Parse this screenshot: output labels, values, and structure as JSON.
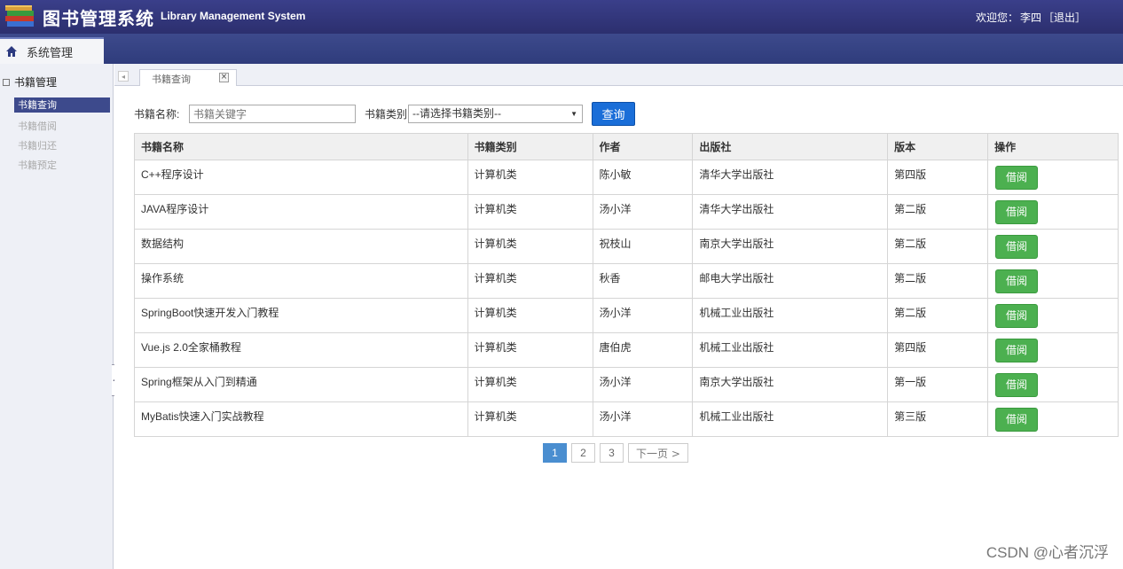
{
  "header": {
    "title": "图书管理系统",
    "subtitle": "Library Management System",
    "welcome_label": "欢迎您：",
    "user_name": "李四",
    "logout_label": "［退出］"
  },
  "nav": {
    "tab_label": "系统管理"
  },
  "sidebar": {
    "group_label": "书籍管理",
    "items": [
      {
        "label": "书籍查询"
      },
      {
        "label": "书籍借阅"
      },
      {
        "label": "书籍归还"
      },
      {
        "label": "书籍预定"
      }
    ]
  },
  "tabs": {
    "active_label": "书籍查询",
    "close_glyph": "×"
  },
  "search": {
    "name_label": "书籍名称:",
    "name_placeholder": "书籍关键字",
    "category_label": "书籍类别:",
    "category_selected": "--请选择书籍类别--",
    "query_label": "查询"
  },
  "table": {
    "columns": [
      "书籍名称",
      "书籍类别",
      "作者",
      "出版社",
      "版本",
      "操作"
    ],
    "rows": [
      {
        "name": "C++程序设计",
        "category": "计算机类",
        "author": "陈小敏",
        "publisher": "清华大学出版社",
        "edition": "第四版",
        "action": "借阅"
      },
      {
        "name": "JAVA程序设计",
        "category": "计算机类",
        "author": "汤小洋",
        "publisher": "清华大学出版社",
        "edition": "第二版",
        "action": "借阅"
      },
      {
        "name": "数据结构",
        "category": "计算机类",
        "author": "祝枝山",
        "publisher": "南京大学出版社",
        "edition": "第二版",
        "action": "借阅"
      },
      {
        "name": "操作系统",
        "category": "计算机类",
        "author": "秋香",
        "publisher": "邮电大学出版社",
        "edition": "第二版",
        "action": "借阅"
      },
      {
        "name": "SpringBoot快速开发入门教程",
        "category": "计算机类",
        "author": "汤小洋",
        "publisher": "机械工业出版社",
        "edition": "第二版",
        "action": "借阅"
      },
      {
        "name": "Vue.js 2.0全家桶教程",
        "category": "计算机类",
        "author": "唐伯虎",
        "publisher": "机械工业出版社",
        "edition": "第四版",
        "action": "借阅"
      },
      {
        "name": "Spring框架从入门到精通",
        "category": "计算机类",
        "author": "汤小洋",
        "publisher": "南京大学出版社",
        "edition": "第一版",
        "action": "借阅"
      },
      {
        "name": "MyBatis快速入门实战教程",
        "category": "计算机类",
        "author": "汤小洋",
        "publisher": "机械工业出版社",
        "edition": "第三版",
        "action": "借阅"
      }
    ]
  },
  "pager": {
    "pages": [
      "1",
      "2",
      "3"
    ],
    "current": "1",
    "next_label": "下一页 >"
  },
  "watermark": "CSDN @心者沉浮",
  "colors": {
    "header_bg": "#2c2f6e",
    "accent_blue": "#1a6ed8",
    "borrow_green": "#4cb050",
    "sidebar_active": "#3d4a8c"
  }
}
